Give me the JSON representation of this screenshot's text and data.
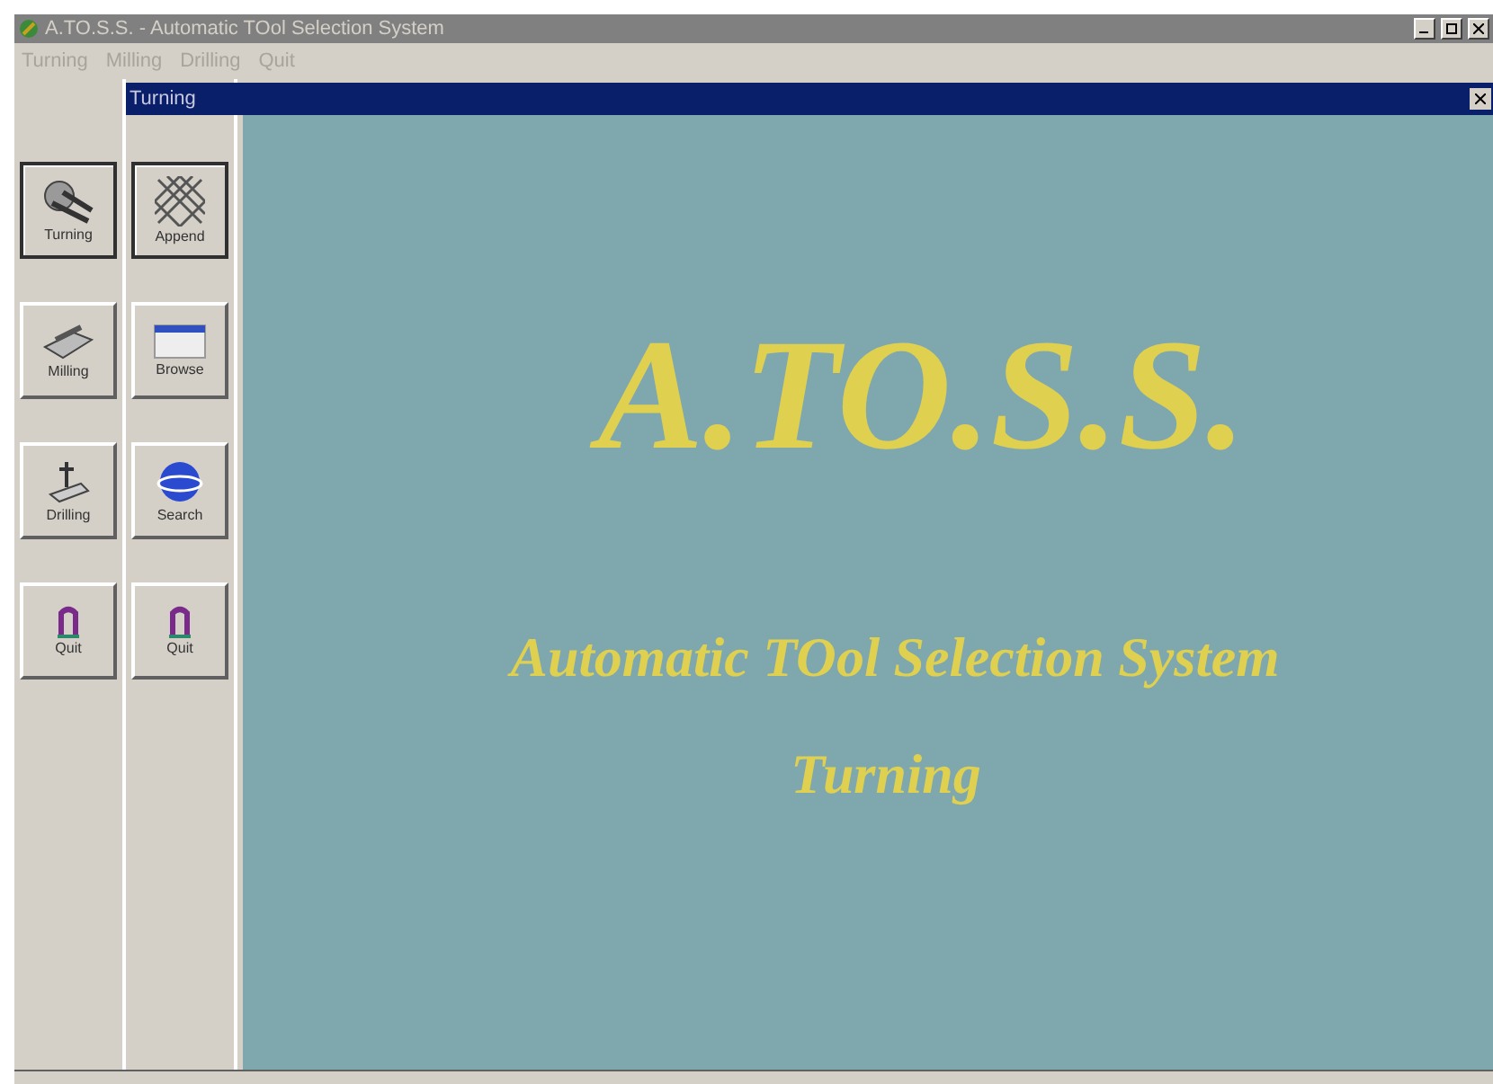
{
  "window": {
    "title": "A.TO.S.S. - Automatic TOol Selection System"
  },
  "menu": [
    "Turning",
    "Milling",
    "Drilling",
    "Quit"
  ],
  "toolbars": [
    {
      "buttons": [
        {
          "label": "Turning",
          "kind": "lathe",
          "selected": true
        },
        {
          "label": "Milling",
          "kind": "mill",
          "selected": false
        },
        {
          "label": "Drilling",
          "kind": "drill",
          "selected": false
        },
        {
          "label": "Quit",
          "kind": "quit",
          "selected": false
        }
      ]
    },
    {
      "buttons": [
        {
          "label": "Append",
          "kind": "grid",
          "selected": true
        },
        {
          "label": "Browse",
          "kind": "browse",
          "selected": false
        },
        {
          "label": "Search",
          "kind": "globe",
          "selected": false
        },
        {
          "label": "Quit",
          "kind": "quit",
          "selected": false
        }
      ]
    }
  ],
  "child_window": {
    "title": "Turning",
    "logo": "A.TO.S.S.",
    "subtitle": "Automatic TOol Selection System",
    "module": "Turning"
  }
}
